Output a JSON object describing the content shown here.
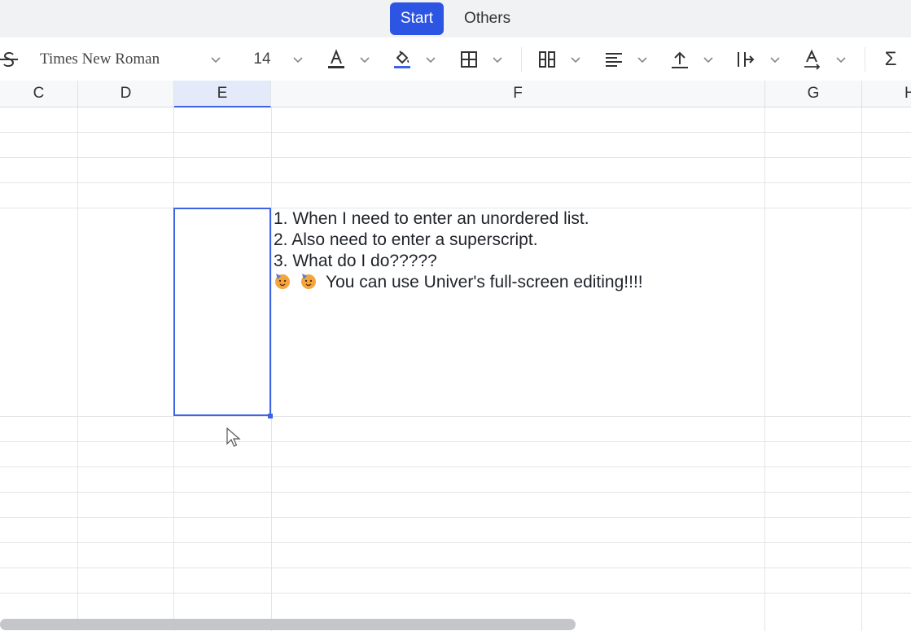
{
  "tabs": [
    {
      "label": "Start",
      "active": true
    },
    {
      "label": "Others",
      "active": false
    }
  ],
  "toolbar": {
    "font_name": "Times New Roman",
    "font_size": "14",
    "sum_symbol": "Σ",
    "icons": [
      "strikethrough-icon",
      "text-color-icon",
      "fill-color-icon",
      "border-icon",
      "merge-cells-icon",
      "horizontal-align-icon",
      "vertical-align-icon",
      "text-wrap-icon",
      "text-rotate-icon",
      "sum-icon"
    ],
    "accent_color": "#2d55e3",
    "fill_underline_color": "#3d63e6"
  },
  "columns": [
    {
      "label": "C",
      "active": false
    },
    {
      "label": "D",
      "active": false
    },
    {
      "label": "E",
      "active": true
    },
    {
      "label": "F",
      "active": false
    },
    {
      "label": "G",
      "active": false
    },
    {
      "label": "H",
      "active": false
    }
  ],
  "cell_content": {
    "line1": "1. When I need to enter an unordered list.",
    "line2": "2. Also need to enter a superscript.",
    "line3": "3. What do I do?????",
    "line4": "You can use Univer's full-screen editing!!!!",
    "line4_emoji": "partying-face-emoji"
  },
  "selection_color": "#3d63e6"
}
